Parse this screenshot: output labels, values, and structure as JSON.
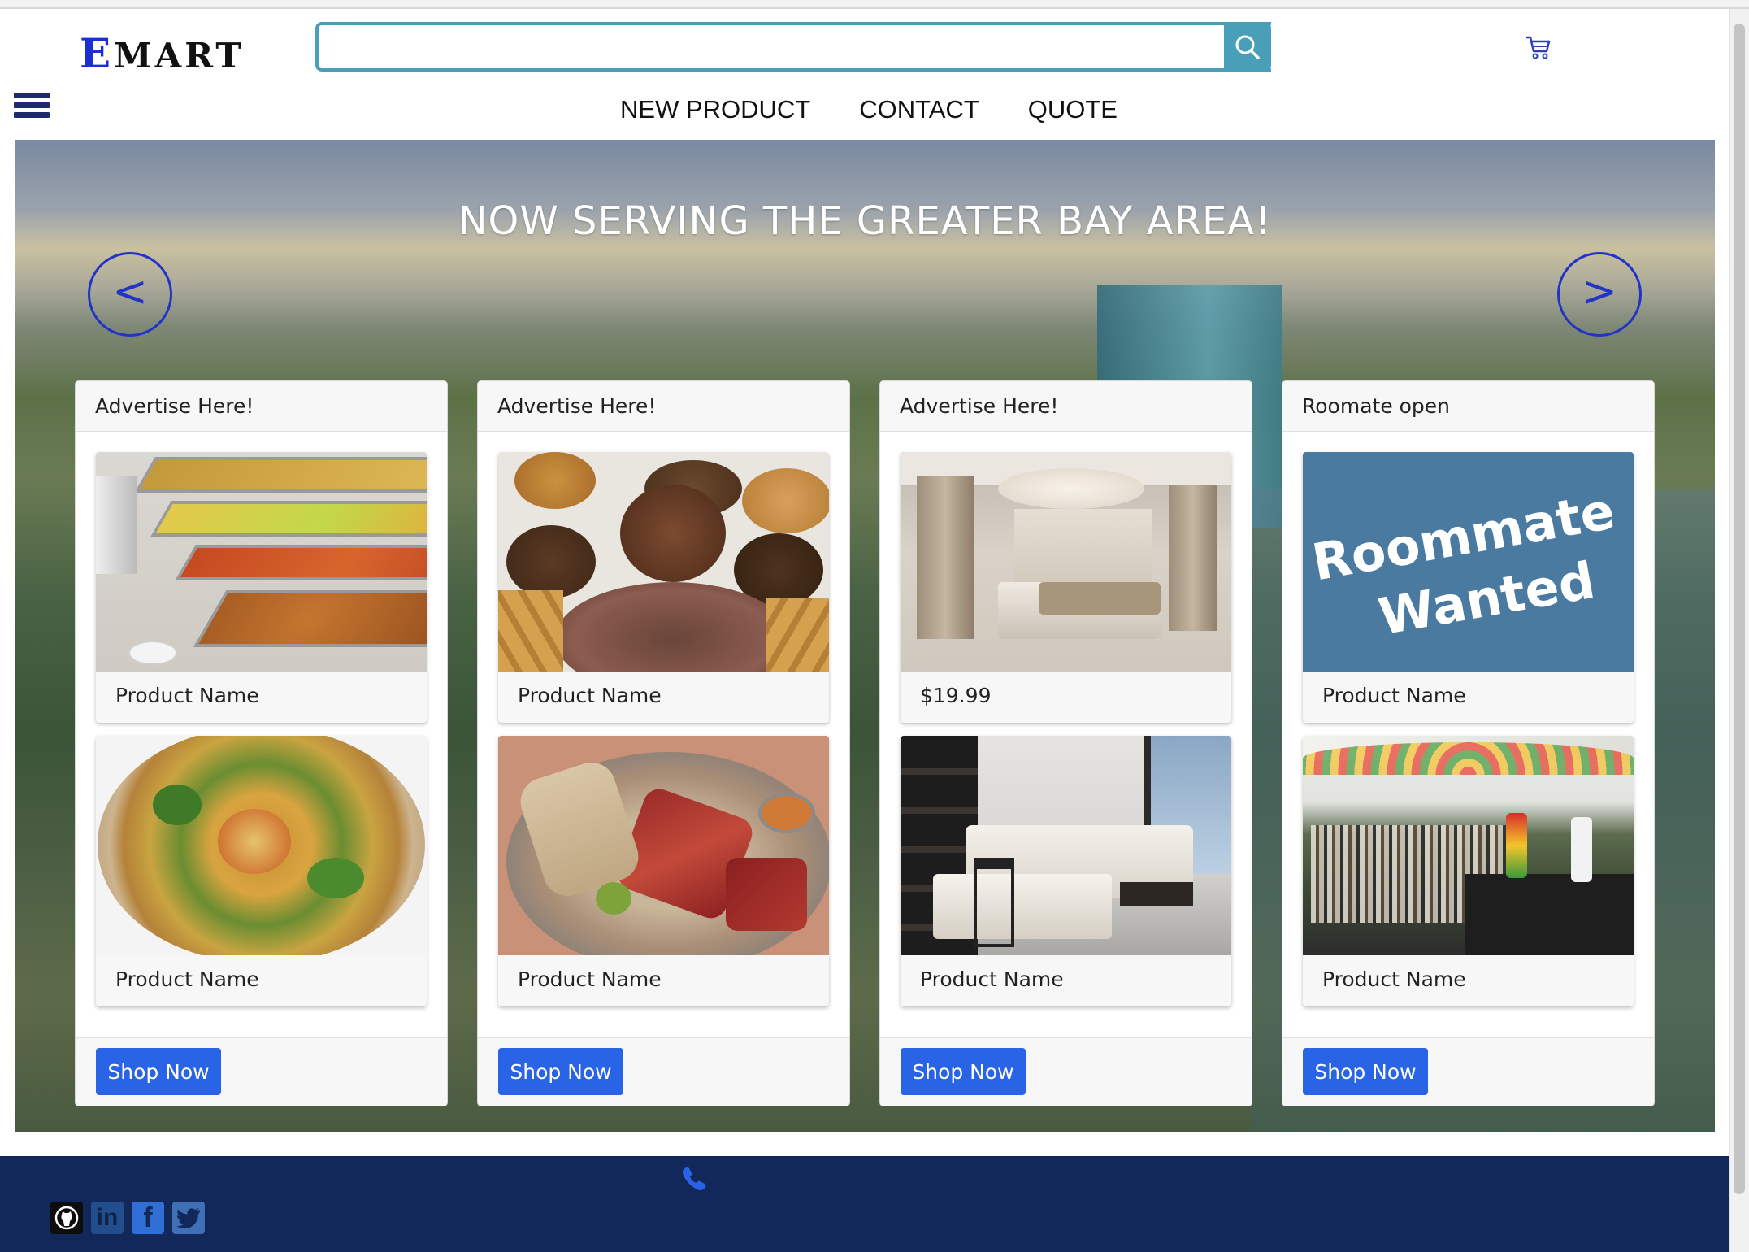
{
  "header": {
    "logo_initial": "E",
    "logo_rest": "MART",
    "search_placeholder": "",
    "search_value": ""
  },
  "nav": {
    "items": [
      {
        "label": "NEW PRODUCT"
      },
      {
        "label": "CONTACT"
      },
      {
        "label": "QUOTE"
      }
    ]
  },
  "hero": {
    "title": "NOW SERVING THE GREATER BAY AREA!",
    "prev_label": "<",
    "next_label": ">"
  },
  "cards": [
    {
      "header": "Advertise Here!",
      "products": [
        {
          "name": "Product Name",
          "image": "buffet-trays"
        },
        {
          "name": "Product Name",
          "image": "injera-platter"
        }
      ],
      "button": "Shop Now"
    },
    {
      "header": "Advertise Here!",
      "products": [
        {
          "name": "Product Name",
          "image": "snack-spread"
        },
        {
          "name": "Product Name",
          "image": "meat-platter"
        }
      ],
      "button": "Shop Now"
    },
    {
      "header": "Advertise Here!",
      "products": [
        {
          "name": "$19.99",
          "image": "bedroom"
        },
        {
          "name": "Product Name",
          "image": "living-room"
        }
      ],
      "button": "Shop Now"
    },
    {
      "header": "Roomate open",
      "products": [
        {
          "name": "Product Name",
          "image": "roommate-wanted-sign",
          "sign_line1": "Roommate",
          "sign_line2": "Wanted"
        },
        {
          "name": "Product Name",
          "image": "outdoor-festival"
        }
      ],
      "button": "Shop Now"
    }
  ],
  "footer": {
    "icons": [
      "phone-icon",
      "github-icon",
      "linkedin-icon",
      "facebook-icon",
      "twitter-icon"
    ],
    "social_labels": {
      "linkedin": "in",
      "facebook": "f"
    }
  },
  "colors": {
    "logo_accent": "#1b2fd6",
    "search_border": "#4a9fb8",
    "nav_arrow": "#2234c6",
    "shop_button": "#2a64e6",
    "footer_bg": "#13285a"
  }
}
